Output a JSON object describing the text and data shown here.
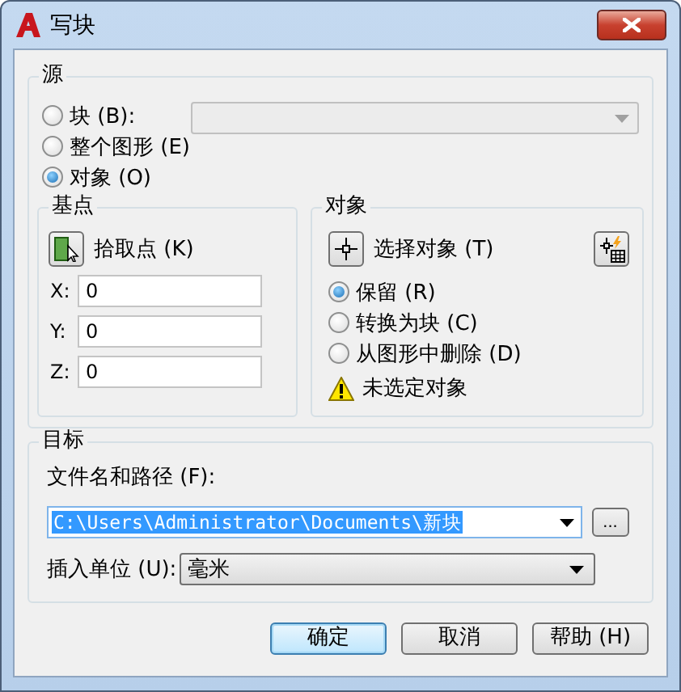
{
  "window": {
    "title": "写块"
  },
  "source": {
    "label": "源",
    "options": [
      {
        "label": "块 (B):",
        "selected": false
      },
      {
        "label": "整个图形 (E)",
        "selected": false
      },
      {
        "label": "对象 (O)",
        "selected": true
      }
    ],
    "block_combo": {
      "disabled": true
    }
  },
  "base_point": {
    "label": "基点",
    "pick_button": "拾取点 (K)",
    "fields": [
      {
        "label": "X:",
        "value": "0"
      },
      {
        "label": "Y:",
        "value": "0"
      },
      {
        "label": "Z:",
        "value": "0"
      }
    ]
  },
  "objects": {
    "label": "对象",
    "select_button": "选择对象 (T)",
    "options": [
      {
        "label": "保留 (R)",
        "selected": true
      },
      {
        "label": "转换为块 (C)",
        "selected": false
      },
      {
        "label": "从图形中删除 (D)",
        "selected": false
      }
    ],
    "warning": "未选定对象"
  },
  "target": {
    "label": "目标",
    "path_label": "文件名和路径 (F):",
    "path_value": "C:\\Users\\Administrator\\Documents\\新块",
    "path_selected": true,
    "browse": "...",
    "units_label": "插入单位 (U):",
    "units_value": "毫米"
  },
  "buttons": [
    {
      "label": "确定",
      "default": true
    },
    {
      "label": "取消",
      "default": false
    },
    {
      "label": "帮助 (H)",
      "default": false
    }
  ]
}
